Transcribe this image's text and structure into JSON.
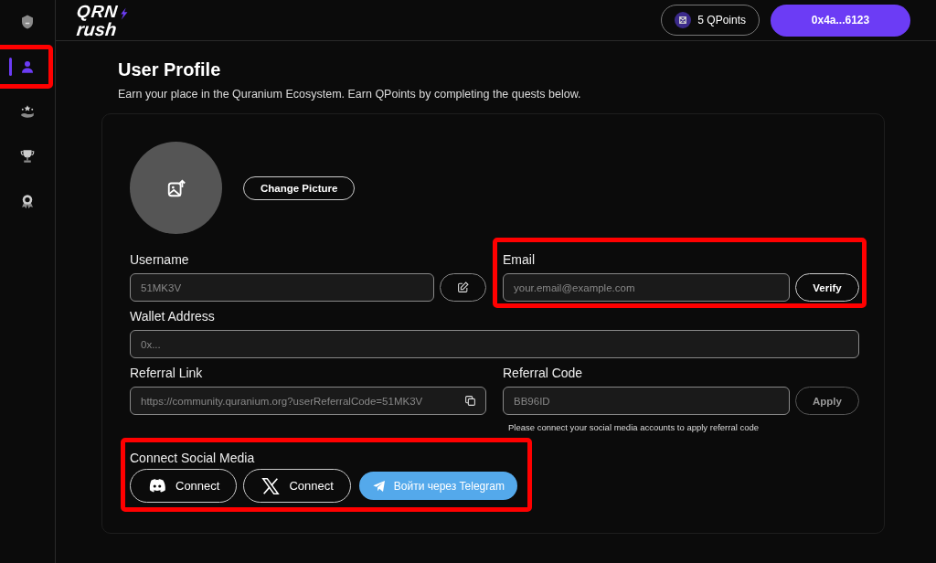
{
  "sidebar": {
    "items": [
      {
        "kind": "shield",
        "selected": false,
        "highlighted": false
      },
      {
        "kind": "user",
        "selected": true,
        "highlighted": true
      },
      {
        "kind": "hand-star",
        "selected": false,
        "highlighted": false
      },
      {
        "kind": "trophy",
        "selected": false,
        "highlighted": false
      },
      {
        "kind": "badge",
        "selected": false,
        "highlighted": false
      }
    ]
  },
  "header": {
    "logo": {
      "line_1": "QRN",
      "line_2": "rush"
    },
    "points": "5 QPoints",
    "wallet_button": "0x4a...6123"
  },
  "page": {
    "title": "User Profile",
    "subtitle": "Earn your place in the Quranium Ecosystem. Earn QPoints by completing the quests below."
  },
  "profile": {
    "change_picture_button": "Change Picture",
    "username": {
      "label": "Username",
      "value": "51MK3V"
    },
    "email": {
      "label": "Email",
      "placeholder": "your.email@example.com",
      "button": "Verify",
      "highlighted": true
    },
    "wallet_address": {
      "label": "Wallet Address",
      "placeholder": "0x..."
    },
    "referral_link": {
      "label": "Referral Link",
      "value": "https://community.quranium.org?userReferralCode=51MK3V"
    },
    "referral_code": {
      "label": "Referral Code",
      "value": "BB96ID",
      "button": "Apply",
      "button_disabled": true,
      "note": "Please connect your social media accounts to apply referral code"
    },
    "social": {
      "label": "Connect Social Media",
      "highlighted": true,
      "buttons": [
        {
          "kind": "discord",
          "label": "Connect"
        },
        {
          "kind": "x",
          "label": "Connect"
        },
        {
          "kind": "telegram",
          "label": "Войти через Telegram"
        }
      ]
    }
  }
}
